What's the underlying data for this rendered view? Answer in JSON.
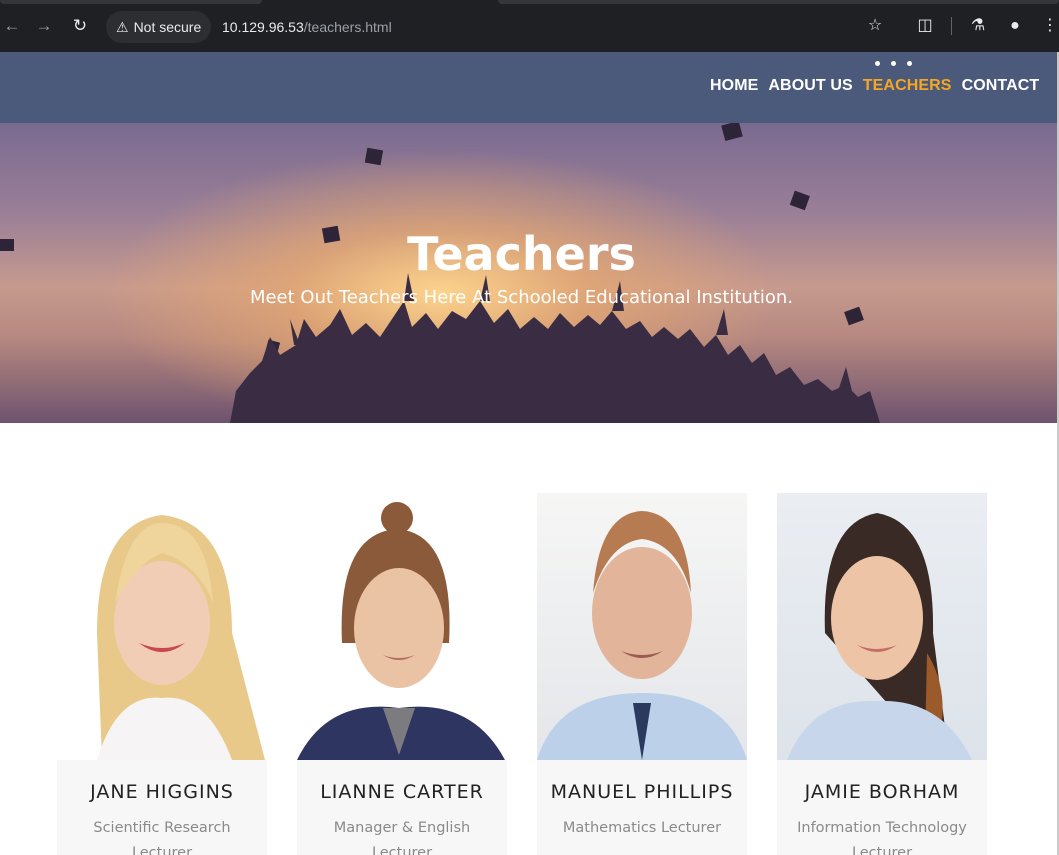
{
  "browser": {
    "security_label": "Not secure",
    "url_host": "10.129.96.53",
    "url_path": "/teachers.html",
    "icons": [
      "back-icon",
      "forward-icon",
      "reload-icon",
      "warning-icon",
      "star-icon",
      "extensions-icon",
      "labs-icon",
      "profile-icon",
      "menu-icon"
    ]
  },
  "nav": {
    "items": [
      {
        "label": "HOME",
        "active": false
      },
      {
        "label": "ABOUT US",
        "active": false
      },
      {
        "label": "TEACHERS",
        "active": true
      },
      {
        "label": "CONTACT",
        "active": false
      }
    ],
    "active_color": "#f5a623",
    "header_color": "#4b5a7a"
  },
  "hero": {
    "title": "Teachers",
    "subtitle": "Meet Out Teachers Here At Schooled Educational Institution."
  },
  "teachers": [
    {
      "name": "JANE HIGGINS",
      "role": "Scientific Research Lecturer"
    },
    {
      "name": "LIANNE CARTER",
      "role": "Manager & English Lecturer"
    },
    {
      "name": "MANUEL PHILLIPS",
      "role": "Mathematics Lecturer"
    },
    {
      "name": "JAMIE BORHAM",
      "role": "Information Technology Lecturer"
    }
  ]
}
